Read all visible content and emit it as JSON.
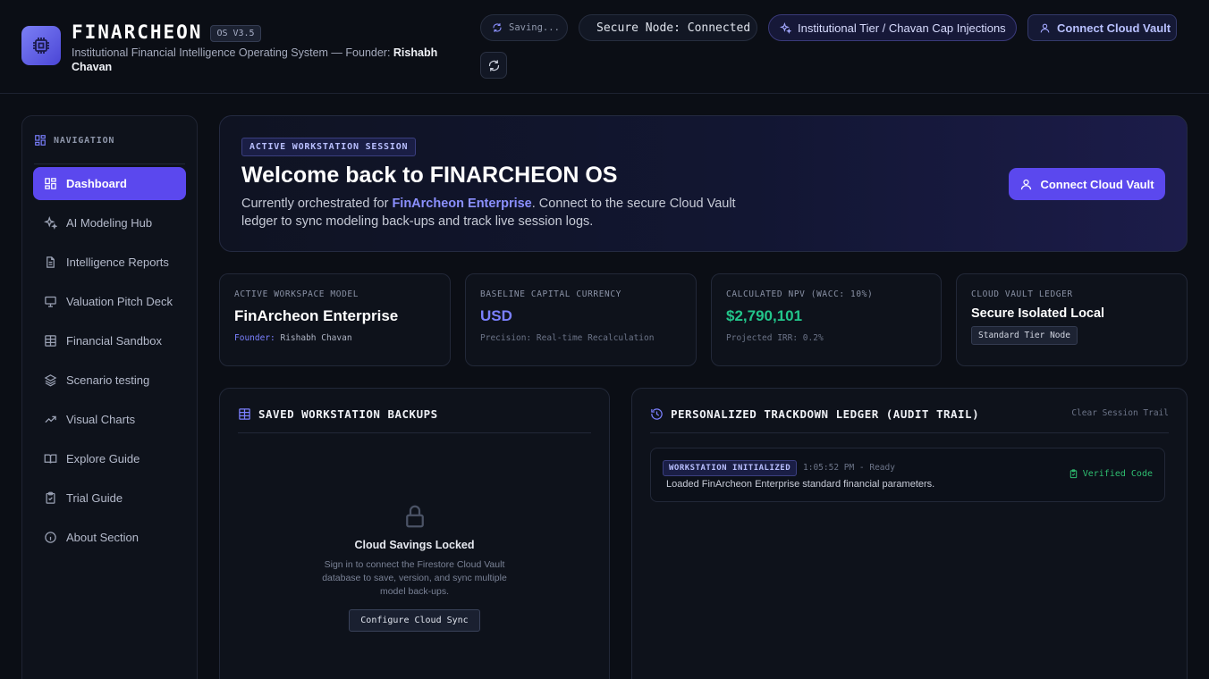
{
  "header": {
    "brand_name": "FINARCHEON",
    "version": "OS V3.5",
    "subtitle_prefix": "Institutional Financial Intelligence Operating System — Founder: ",
    "founder": "Rishabh Chavan",
    "saving_label": "Saving...",
    "secure_label": "Secure Node: Connected",
    "tier_label": "Institutional Tier / Chavan Cap Injections",
    "vault_button": "Connect Cloud Vault",
    "icons": [
      "cpu-chip-icon",
      "sync-icon",
      "sparkle-icon",
      "user-icon",
      "refresh-icon"
    ],
    "status_color": "#22c55e"
  },
  "sidebar": {
    "title": "NAVIGATION",
    "items": [
      {
        "label": "Dashboard",
        "icon": "dashboard-icon",
        "active": true
      },
      {
        "label": "AI Modeling Hub",
        "icon": "sparkle-icon"
      },
      {
        "label": "Intelligence Reports",
        "icon": "document-icon"
      },
      {
        "label": "Valuation Pitch Deck",
        "icon": "presentation-icon"
      },
      {
        "label": "Financial Sandbox",
        "icon": "table-icon"
      },
      {
        "label": "Scenario testing",
        "icon": "layers-icon"
      },
      {
        "label": "Visual Charts",
        "icon": "trending-up-icon"
      },
      {
        "label": "Explore Guide",
        "icon": "book-icon"
      },
      {
        "label": "Trial Guide",
        "icon": "clipboard-icon"
      },
      {
        "label": "About Section",
        "icon": "info-icon"
      }
    ],
    "accent_color": "#5b48ee"
  },
  "hero": {
    "tag": "ACTIVE WORKSTATION SESSION",
    "title": "Welcome back to FINARCHEON OS",
    "text_prefix": "Currently orchestrated for ",
    "entity": "FinArcheon Enterprise",
    "text_suffix": ". Connect to the secure Cloud Vault ledger to sync modeling back-ups and track live session logs.",
    "button": "Connect Cloud Vault"
  },
  "stats": [
    {
      "label": "ACTIVE WORKSPACE MODEL",
      "value": "FinArcheon Enterprise",
      "sub_key": "Founder:",
      "sub_value": " Rishabh Chavan"
    },
    {
      "label": "BASELINE CAPITAL CURRENCY",
      "value": "USD",
      "sub": "Precision: Real-time Recalculation",
      "value_color": "#7b80ff"
    },
    {
      "label": "CALCULATED NPV (WACC: 10%)",
      "value": "$2,790,101",
      "sub": "Projected IRR: 0.2%",
      "value_color": "#22c58a"
    },
    {
      "label": "CLOUD VAULT LEDGER",
      "value": "Secure Isolated Local",
      "chip": "Standard Tier Node"
    }
  ],
  "backups": {
    "title": "SAVED WORKSTATION BACKUPS",
    "locked_title": "Cloud Savings Locked",
    "locked_text": "Sign in to connect the Firestore Cloud Vault database to save, version, and sync multiple model back-ups.",
    "button": "Configure Cloud Sync"
  },
  "ledger": {
    "title": "PERSONALIZED TRACKDOWN LEDGER (AUDIT TRAIL)",
    "clear": "Clear Session Trail",
    "entries": [
      {
        "tag": "WORKSTATION INITIALIZED",
        "time": "1:05:52 PM - Ready",
        "message": "Loaded FinArcheon Enterprise standard financial parameters.",
        "status": "Verified Code"
      }
    ]
  }
}
